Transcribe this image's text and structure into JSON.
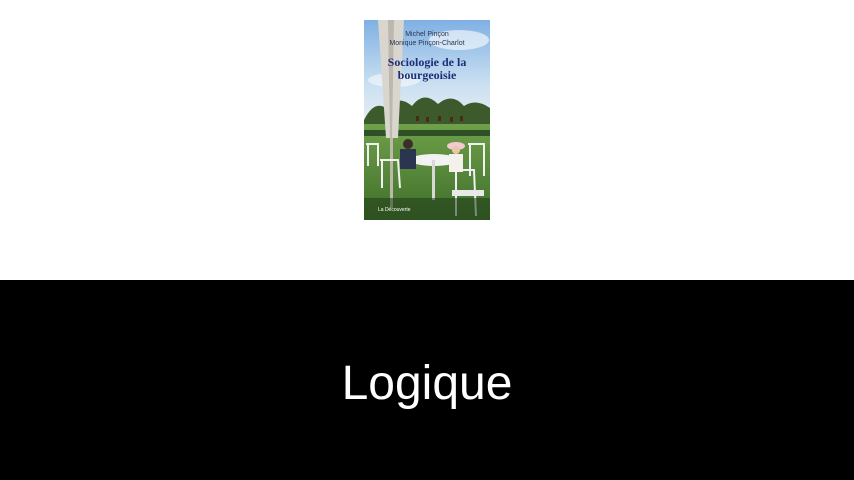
{
  "book": {
    "authors": [
      "Michel Pinçon",
      "Monique Pinçon-Charlot"
    ],
    "title_lines": [
      "Sociologie de la",
      "bourgeoisie"
    ],
    "publisher": "La Découverte"
  },
  "caption": {
    "text": "Logique"
  },
  "colors": {
    "caption_background": "#000000",
    "caption_text": "#ffffff",
    "page_background": "#ffffff",
    "cover_title": "#1d2f7a"
  }
}
